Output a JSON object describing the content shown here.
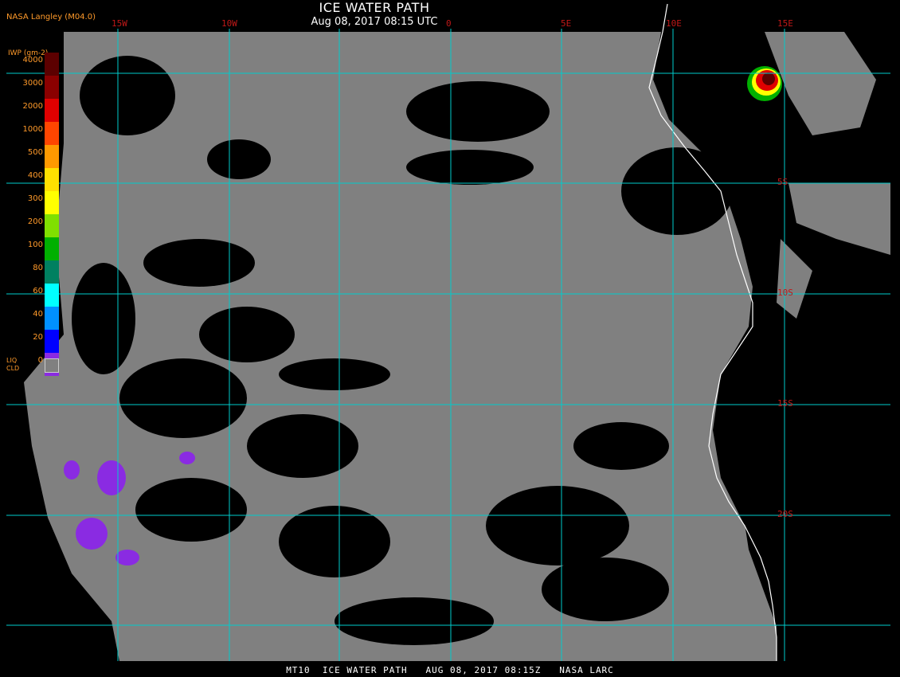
{
  "header": {
    "title": "ICE WATER PATH",
    "subtitle": "Aug 08, 2017 08:15 UTC",
    "agency": "NASA Langley (M04.0)"
  },
  "footer": {
    "text": "MT10  ICE WATER PATH   AUG 08, 2017 08:15Z   NASA LARC"
  },
  "longitude_labels": [
    "15W",
    "10W",
    "0",
    "5E",
    "10E",
    "15E"
  ],
  "latitude_labels": [
    "5S",
    "10S",
    "15S",
    "20S"
  ],
  "legend": {
    "unit": "IWP (gm-2)",
    "ticks": [
      "4000",
      "3000",
      "2000",
      "1000",
      "500",
      "400",
      "300",
      "200",
      "100",
      "80",
      "60",
      "40",
      "20",
      "0"
    ],
    "colors": [
      "#5c0000",
      "#8b0000",
      "#e00000",
      "#ff4500",
      "#ff9900",
      "#ffe000",
      "#ffff00",
      "#80e000",
      "#00b000",
      "#008060",
      "#00ffff",
      "#0090ff",
      "#0000ff",
      "#8a2be2"
    ],
    "liquid_cloud_label": "LIQ CLD",
    "liquid_cloud_color": "#808080"
  },
  "colors": {
    "clear_sky": "#000000",
    "liquid_cloud": "#808080",
    "grid": "#00cccc",
    "coastline": "#ffffff",
    "label_red": "#c01818",
    "label_orange": "#ff9a2a"
  }
}
